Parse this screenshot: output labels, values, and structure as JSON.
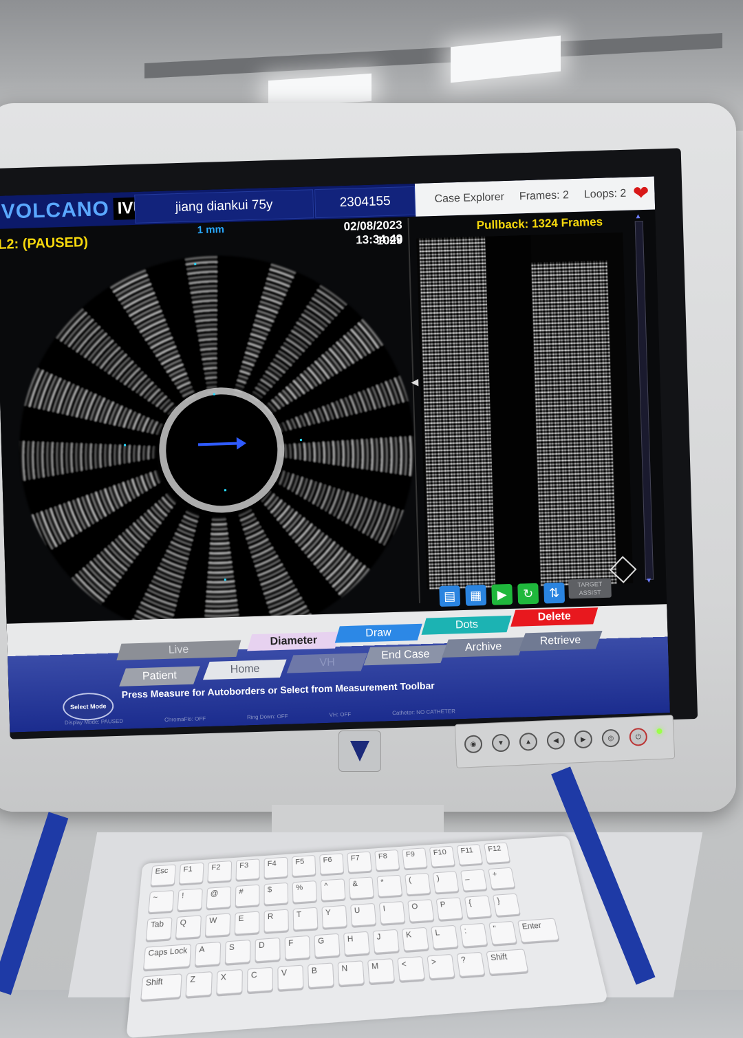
{
  "header": {
    "logo_brand": "VOLCANO",
    "logo_product": "IVUS",
    "patient_name": "jiang diankui 75y",
    "case_number": "2304155",
    "case_explorer": "Case Explorer",
    "frames": "Frames: 2",
    "loops": "Loops: 2"
  },
  "viewer": {
    "loop_status": "L2: (PAUSED)",
    "scale_label": "1 mm",
    "datetime": "02/08/2023 13:34:49",
    "frame_number": "1029"
  },
  "longitudinal": {
    "pullback_label": "Pullback: 1324 Frames",
    "target_button": "TARGET ASSIST"
  },
  "measurement_toolbar": {
    "live": "Live",
    "diameter": "Diameter",
    "draw": "Draw",
    "dots": "Dots",
    "delete": "Delete"
  },
  "nav": {
    "patient": "Patient",
    "home": "Home",
    "vh": "VH",
    "end_case": "End Case",
    "archive": "Archive",
    "retrieve": "Retrieve"
  },
  "select_mode": "Select Mode",
  "message": "Press Measure for Autoborders or Select from Measurement Toolbar",
  "status_line": {
    "display_mode": "Display Mode: PAUSED",
    "chromaflo": "ChromaFlo: OFF",
    "ring_down": "Ring Down: OFF",
    "vh": "VH: OFF",
    "catheter": "Catheter: NO CATHETER"
  },
  "colors": {
    "header_blue": "#0c1a6a",
    "status_yellow": "#f5d70c",
    "delete_red": "#e8181e",
    "draw_blue": "#2c88e6",
    "dots_teal": "#1cb3b3",
    "play_green": "#1fb83c"
  },
  "icons": {
    "heart": "heart-icon",
    "playback": [
      "bookmark-down-icon",
      "book-icon",
      "play-icon",
      "loop-icon",
      "split-view-icon"
    ]
  },
  "keyboard_rows": [
    [
      "Esc",
      "F1",
      "F2",
      "F3",
      "F4",
      "F5",
      "F6",
      "F7",
      "F8",
      "F9",
      "F10",
      "F11",
      "F12"
    ],
    [
      "~",
      "!",
      "@",
      "#",
      "$",
      "%",
      "^",
      "&",
      "*",
      "(",
      ")",
      "_",
      "+"
    ],
    [
      "Tab",
      "Q",
      "W",
      "E",
      "R",
      "T",
      "Y",
      "U",
      "I",
      "O",
      "P",
      "{",
      "}"
    ],
    [
      "Caps Lock",
      "A",
      "S",
      "D",
      "F",
      "G",
      "H",
      "J",
      "K",
      "L",
      ":",
      "\"",
      "Enter"
    ],
    [
      "Shift",
      "Z",
      "X",
      "C",
      "V",
      "B",
      "N",
      "M",
      "<",
      ">",
      "?",
      "Shift"
    ]
  ]
}
